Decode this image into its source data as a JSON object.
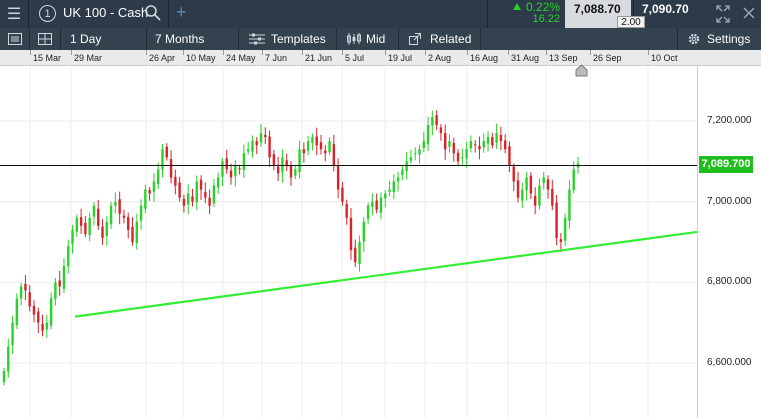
{
  "header": {
    "menu_icon": "hamburger-icon",
    "slot_number": "1",
    "instrument": "UK 100 - Cash",
    "search_icon": "search-icon",
    "add_icon": "plus-icon",
    "change_pct": "0.22%",
    "change_abs": "16.22",
    "bid": "7,088.70",
    "ask": "7,090.70",
    "spread": "2.00",
    "colors": {
      "up": "#29d12a",
      "down": "#d8232a",
      "bar": "#2d3a4a"
    }
  },
  "toolbar": {
    "interval": "1 Day",
    "range": "7 Months",
    "templates": "Templates",
    "price_mode": "Mid",
    "related": "Related",
    "settings": "Settings"
  },
  "chart_data": {
    "type": "candlestick",
    "title": "",
    "x_labels": [
      "15 Mar",
      "29 Mar",
      "26 Apr",
      "10 May",
      "24 May",
      "7 Jun",
      "21 Jun",
      "5 Jul",
      "19 Jul",
      "2 Aug",
      "16 Aug",
      "31 Aug",
      "13 Sep",
      "26 Sep",
      "10 Oct"
    ],
    "y_ticks": [
      "7,200.000",
      "7,000.000",
      "6,800.000",
      "6,600.000"
    ],
    "ylim": [
      6560,
      7300
    ],
    "current_price": 7089.7,
    "current_price_label": "7,089.700",
    "close_series": [
      6580,
      6640,
      6700,
      6760,
      6790,
      6780,
      6740,
      6720,
      6700,
      6680,
      6700,
      6760,
      6800,
      6790,
      6840,
      6890,
      6930,
      6960,
      6940,
      6920,
      6960,
      6990,
      6940,
      6910,
      6950,
      6990,
      7000,
      6970,
      6960,
      6930,
      6900,
      6950,
      6990,
      7030,
      7020,
      7050,
      7080,
      7130,
      7110,
      7060,
      7040,
      7010,
      6990,
      7020,
      7000,
      7050,
      7030,
      7010,
      6990,
      7040,
      7060,
      7100,
      7080,
      7060,
      7090,
      7080,
      7120,
      7130,
      7150,
      7140,
      7170,
      7160,
      7110,
      7090,
      7070,
      7110,
      7090,
      7060,
      7080,
      7130,
      7120,
      7150,
      7160,
      7140,
      7130,
      7120,
      7150,
      7090,
      7030,
      7000,
      6960,
      6880,
      6850,
      6900,
      6950,
      6990,
      7000,
      6980,
      7010,
      7020,
      7030,
      7050,
      7060,
      7080,
      7100,
      7110,
      7120,
      7130,
      7150,
      7190,
      7210,
      7190,
      7170,
      7130,
      7150,
      7120,
      7100,
      7110,
      7130,
      7150,
      7140,
      7130,
      7150,
      7160,
      7140,
      7170,
      7150,
      7130,
      7090,
      7050,
      7010,
      7030,
      7060,
      7020,
      6990,
      7040,
      7060,
      7030,
      6990,
      6910,
      6900,
      6960,
      7030,
      7080,
      7095
    ],
    "trendline": {
      "from": {
        "index": 15,
        "value": 6715
      },
      "to": {
        "index": 180,
        "value": 6925
      },
      "color": "#33ee33"
    }
  }
}
